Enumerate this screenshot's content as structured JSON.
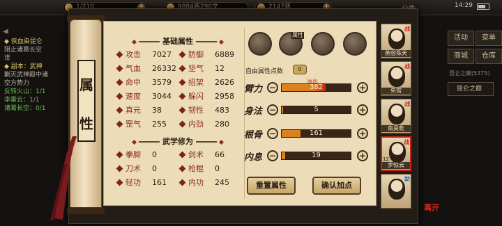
{
  "top_bar": {
    "res1": "1/210",
    "res2": "9884两290文",
    "res3": "2147两",
    "notice": "公告",
    "clock": "14:29"
  },
  "quest": {
    "lines": [
      {
        "text": "◆ 侠血染昆仑",
        "style": "q-title"
      },
      {
        "text": "阻止诸葛长空",
        "style": "q-text"
      },
      {
        "text": "世",
        "style": "q-text"
      },
      {
        "text": "◆ 副本：武神",
        "style": "q-title"
      },
      {
        "text": "剿灭武神殿中诸",
        "style": "q-text"
      },
      {
        "text": "空方势力",
        "style": "q-text"
      },
      {
        "text": "反转火山：1/1",
        "style": "q-sub"
      },
      {
        "text": "李雷云：1/1",
        "style": "q-sub"
      },
      {
        "text": "诸葛长空：0/1",
        "style": "q-sub"
      }
    ]
  },
  "right_menu": {
    "activity": "活动",
    "sail": "菜单",
    "shop": "商城",
    "warehouse": "仓库",
    "kunlun_small": "昆仑之巅(5375)",
    "kunlun_tab": "昆仑之巅"
  },
  "scroll_title": [
    "属",
    "性"
  ],
  "sections": {
    "basic": "基础属性",
    "martial": "武学修为"
  },
  "basic_stats": [
    {
      "name": "攻击",
      "value": "7027"
    },
    {
      "name": "防御",
      "value": "6889"
    },
    {
      "name": "气血",
      "value": "26332"
    },
    {
      "name": "坚气",
      "value": "12"
    },
    {
      "name": "命中",
      "value": "3579"
    },
    {
      "name": "招架",
      "value": "2626"
    },
    {
      "name": "速度",
      "value": "3044"
    },
    {
      "name": "躲闪",
      "value": "2958"
    },
    {
      "name": "真元",
      "value": "38"
    },
    {
      "name": "韧性",
      "value": "483"
    },
    {
      "name": "罡气",
      "value": "255"
    },
    {
      "name": "内劲",
      "value": "280"
    }
  ],
  "martial_stats": [
    {
      "name": "拳脚",
      "value": "0"
    },
    {
      "name": "剑术",
      "value": "66"
    },
    {
      "name": "刀术",
      "value": "0"
    },
    {
      "name": "枪棍",
      "value": "0"
    },
    {
      "name": "轻功",
      "value": "161"
    },
    {
      "name": "内功",
      "value": "245"
    }
  ],
  "skill_icons": [
    {
      "icon": "hat-warrior-icon",
      "tag": ""
    },
    {
      "icon": "scroll-attribute-icon",
      "tag": "属性"
    },
    {
      "icon": "yin-yang-icon",
      "tag": ""
    },
    {
      "icon": "meridian-body-icon",
      "tag": ""
    }
  ],
  "free_points": {
    "label": "自由属性点数",
    "value": "0"
  },
  "attributes": [
    {
      "name": "臂力",
      "value": "382",
      "fill": 0.64,
      "overflow": "溢出"
    },
    {
      "name": "身法",
      "value": "5",
      "fill": 0.02
    },
    {
      "name": "根骨",
      "value": "161",
      "fill": 0.27
    },
    {
      "name": "内息",
      "value": "19",
      "fill": 0.05
    }
  ],
  "colors": {
    "fill_normal": "#d9821e",
    "fill_overflow": "#c8261a"
  },
  "buttons": {
    "reset": "重置属性",
    "confirm": "确认加点"
  },
  "characters": [
    {
      "name": "燕容殊天",
      "flag": "战",
      "flag_color": "red"
    },
    {
      "name": "央宫",
      "flag": "战",
      "flag_color": "red"
    },
    {
      "name": "南昊乾",
      "flag": "战",
      "flag_color": "red"
    },
    {
      "name": "步惊云",
      "flag": "战",
      "flag_color": "red",
      "active": true,
      "num": "12"
    },
    {
      "name": "",
      "flag": "助",
      "flag_color": "blue"
    }
  ],
  "seal": "离开"
}
